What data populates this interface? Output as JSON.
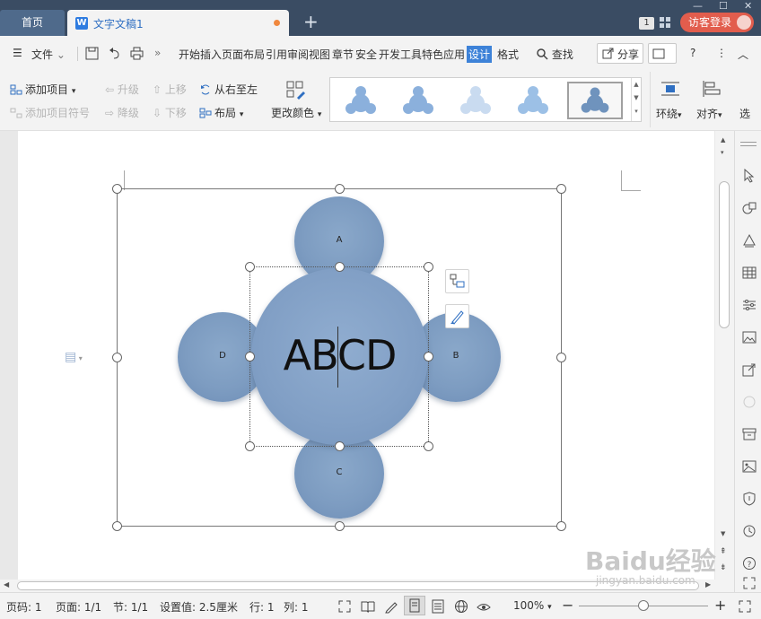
{
  "titlebar": {
    "home_tab": "首页",
    "doc_tab": "文字文稿1",
    "badge": "1",
    "login": "访客登录"
  },
  "menubar": {
    "file": "文件",
    "more": "»",
    "tabs": [
      "开始",
      "插入",
      "页面布局",
      "引用",
      "审阅",
      "视图",
      "章节",
      "安全",
      "开发工具",
      "特色应用",
      "设计",
      "格式"
    ],
    "active_tab": "设计",
    "search": "查找",
    "share": "分享",
    "help": "?"
  },
  "ribbon": {
    "add_item": "添加项目",
    "add_bullet": "添加项目符号",
    "promote": "升级",
    "demote": "降级",
    "move_up": "上移",
    "move_down": "下移",
    "right_to_left": "从右至左",
    "layout": "布局",
    "change_color": "更改颜色",
    "wrap": "环绕",
    "align": "对齐",
    "select": "选"
  },
  "smartart": {
    "center_text": "ABCD",
    "top": "A",
    "right": "B",
    "bottom": "C",
    "left": "D"
  },
  "statusbar": {
    "page_num": "页码: 1",
    "pages": "页面: 1/1",
    "section": "节: 1/1",
    "setting": "设置值: 2.5厘米",
    "row": "行: 1",
    "col": "列: 1",
    "zoom": "100%",
    "minus": "−",
    "plus": "+"
  },
  "watermark": {
    "brand": "Baidu经验",
    "url": "jingyan.baidu.com"
  },
  "colors": {
    "titlebar": "#3a4c63",
    "accent": "#3d82d8",
    "login": "#e25d4d",
    "circle": "#7d9cc1"
  }
}
